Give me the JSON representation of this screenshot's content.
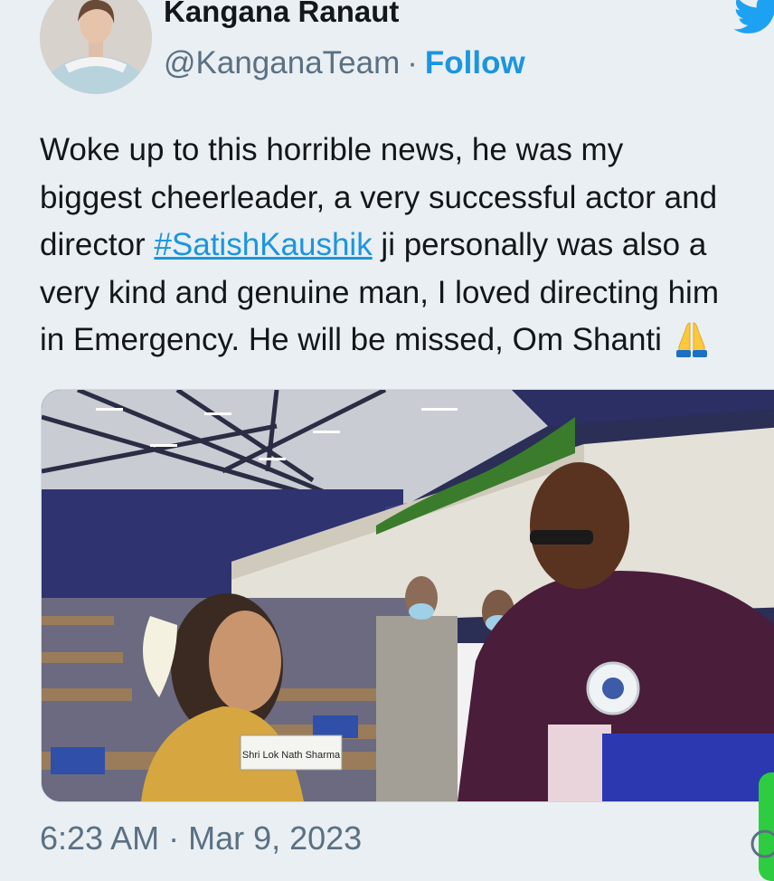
{
  "tweet": {
    "author_name": "Kangana Ranaut",
    "handle": "@KanganaTeam",
    "separator": "·",
    "follow_label": "Follow",
    "text_line1": "Woke up to this horrible news, he was my",
    "text_line2": "biggest cheerleader, a very successful actor and",
    "text_line3_pre": "director ",
    "hashtag": "#SatishKaushik",
    "text_line3_post": " ji personally was also a",
    "text_line4": "very kind and genuine man, I loved directing him",
    "text_line5": "in Emergency. He will be missed, Om Shanti ",
    "emoji": "folded-hands-emoji",
    "media_sign_text": "Shri Lok Nath Sharma",
    "timestamp": "6:23 AM · Mar 9, 2023"
  },
  "icons": {
    "twitter": "twitter-bird-icon",
    "info": "info-icon"
  },
  "colors": {
    "background": "#e9eff3",
    "link": "#1b95e0",
    "secondary_text": "#5b7083",
    "primary_text": "#14171a"
  }
}
